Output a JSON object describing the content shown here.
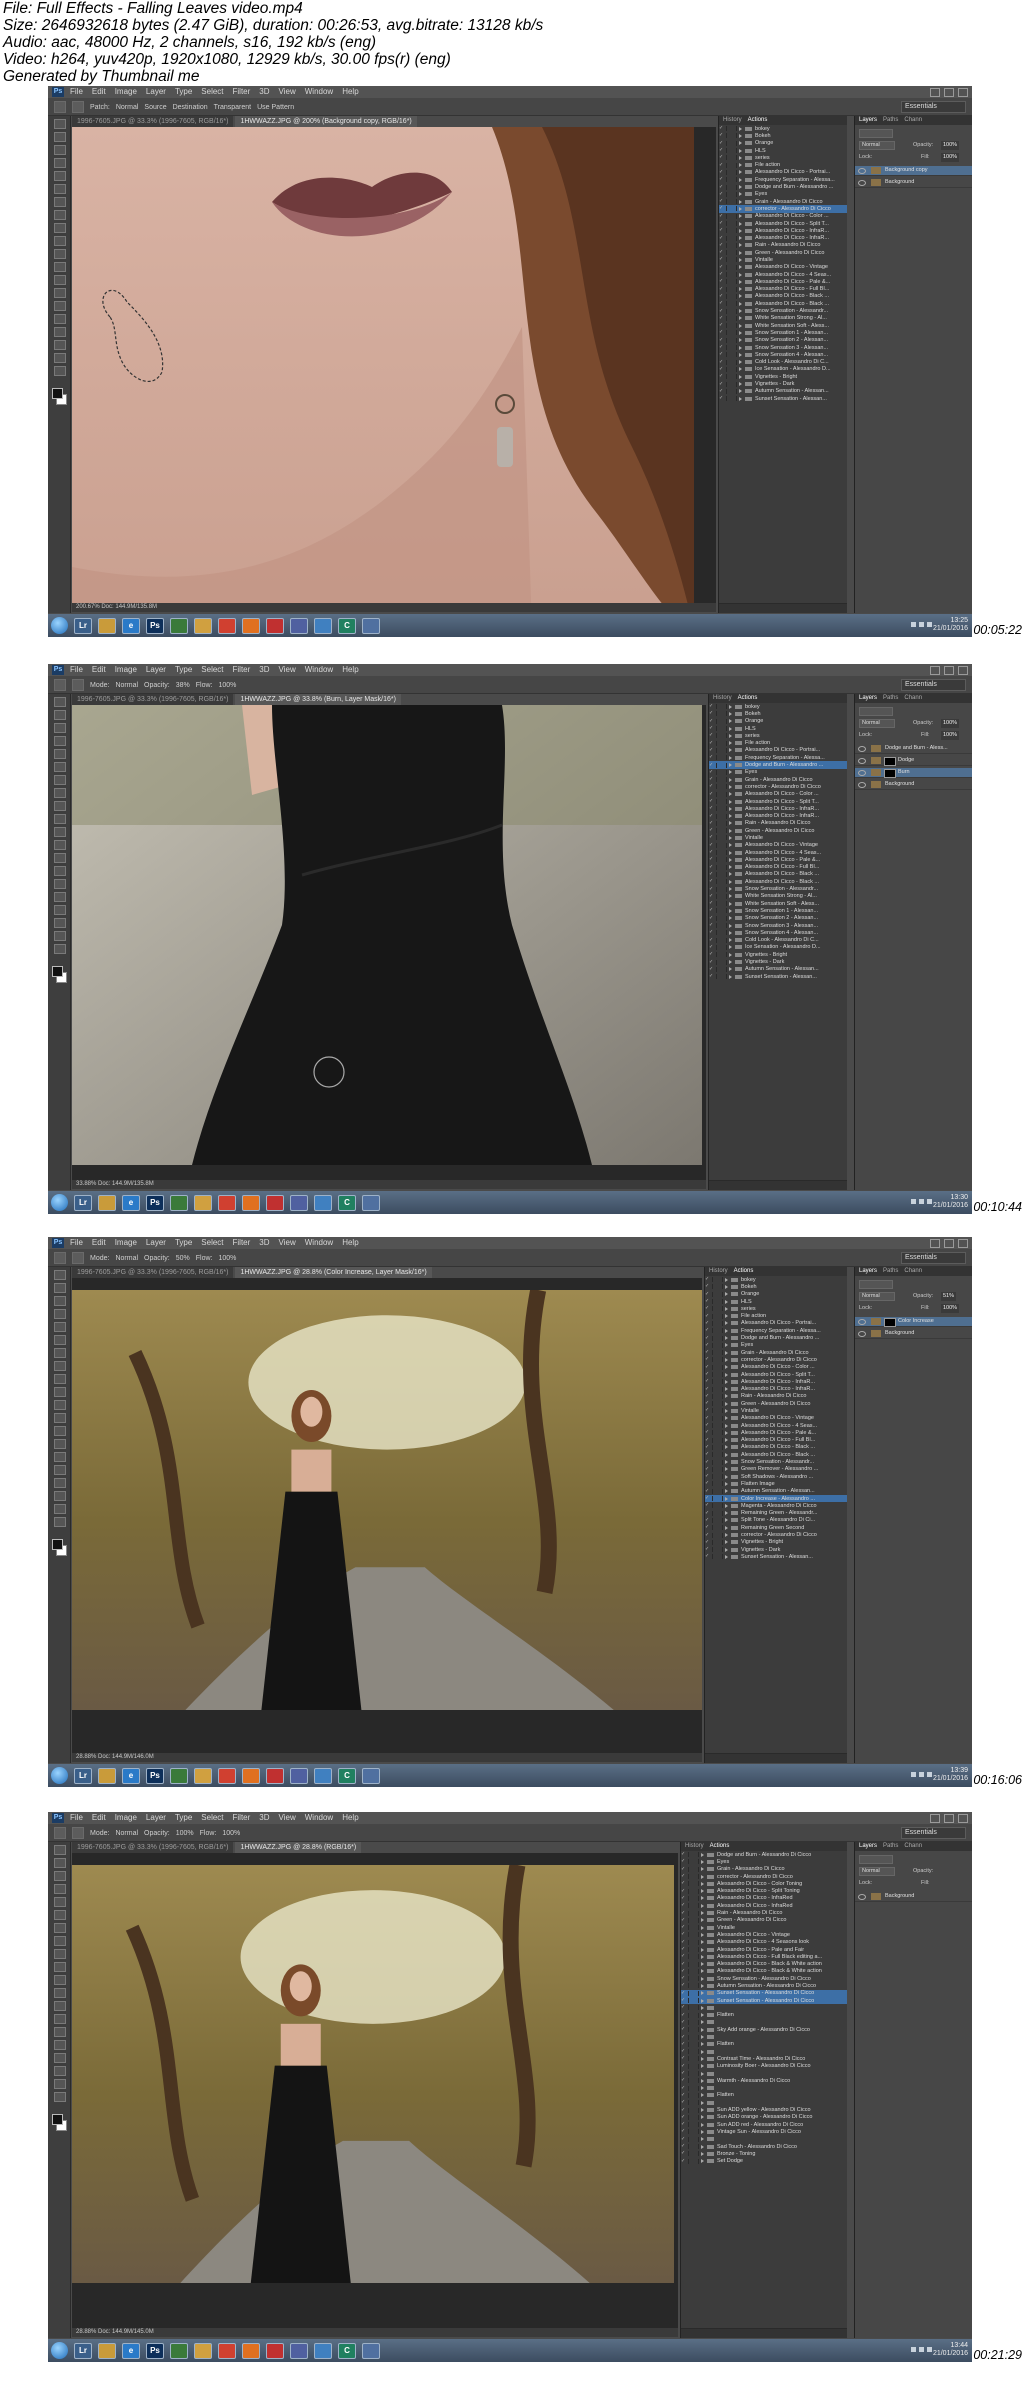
{
  "header": {
    "line1": "File: Full Effects - Falling Leaves video.mp4",
    "line2": "Size: 2646932618 bytes (2.47 GiB), duration: 00:26:53, avg.bitrate: 13128 kb/s",
    "line3": "Audio: aac, 48000 Hz, 2 channels, s16, 192 kb/s (eng)",
    "line4": "Video: h264, yuv420p, 1920x1080, 12929 kb/s, 30.00 fps(r) (eng)",
    "line5": "Generated by Thumbnail me"
  },
  "ps_menus": [
    "File",
    "Edit",
    "Image",
    "Layer",
    "Type",
    "Select",
    "Filter",
    "3D",
    "View",
    "Window",
    "Help"
  ],
  "workspace": "Essentials",
  "panel_tabs": {
    "history": "History",
    "actions": "Actions",
    "layers": "Layers",
    "paths": "Paths",
    "channels": "Chann"
  },
  "taskbar_icons": [
    "Lr",
    "e",
    "Ps",
    "C"
  ],
  "frames": [
    {
      "timestamp": "00:05:22",
      "options": [
        "Patch:",
        "Normal",
        "Source",
        "Destination",
        "Transparent",
        "Use Pattern"
      ],
      "tabs": [
        {
          "label": "1996-7605.JPG @ 33.3% (1996-7605, RGB/16*)",
          "active": false
        },
        {
          "label": "1HWWAZZ.JPG @ 200% (Background copy, RGB/16*)",
          "active": true
        }
      ],
      "status": "200.67%  Doc: 144.9M/135.8M",
      "clock": {
        "time": "13:25",
        "date": "21/01/2016"
      },
      "layers": {
        "blend": "Normal",
        "opacity_label": "Opacity:",
        "opacity": "100%",
        "fill_label": "Fill:",
        "fill": "100%",
        "lock": "Lock:",
        "items": [
          {
            "name": "Background copy",
            "selected": true,
            "mask": false
          },
          {
            "name": "Background",
            "selected": false,
            "mask": false
          }
        ]
      },
      "actions": [
        "bokey",
        "Bokeh",
        "Orange",
        "HLS",
        "series",
        "File action",
        "Alessandro Di Cicco - Portrai...",
        "Frequency Separation - Alessa...",
        "Dodge and Burn - Alessandro ...",
        "Eyes",
        "Grain - Alessandro Di Cicco",
        "corrector - Alessandro Di Cicco",
        "Alessandro Di Cicco - Color ...",
        "Alessandro Di Cicco - Split T...",
        "Alessandro Di Cicco - InfraR...",
        "Alessandro Di Cicco - InfraR...",
        "Rain - Alessandro Di Cicco",
        "Green - Alessandro Di Cicco",
        "Vintalle",
        "Alessandro Di Cicco - Vintage",
        "Alessandro Di Cicco - 4 Seas...",
        "Alessandro Di Cicco - Pale &...",
        "Alessandro Di Cicco - Full Bl...",
        "Alessandro Di Cicco - Black ...",
        "Alessandro Di Cicco - Black ...",
        "Snow Sensation - Alessandr...",
        "White Sensation Strong - Al...",
        "White Sensation Soft - Aless...",
        "Snow Sensation 1 - Alessan...",
        "Snow Sensation 2 - Alessan...",
        "Snow Sensation 3 - Alessan...",
        "Snow Sensation 4 - Alessan...",
        "Cold Look - Alessandro Di C...",
        "Ice Sensation - Alessandro D...",
        "Vignettes - Bright",
        "Vignettes - Dark",
        "Autumn Sensation - Alessan...",
        "Sunset Sensation - Alessan..."
      ],
      "selected_action": "corrector - Alessandro Di Cicco"
    },
    {
      "timestamp": "00:10:44",
      "options": [
        "Mode:",
        "Normal",
        "Opacity:",
        "38%",
        "Flow:",
        "100%"
      ],
      "tabs": [
        {
          "label": "1996-7605.JPG @ 33.3% (1996-7605, RGB/16*)",
          "active": false
        },
        {
          "label": "1HWWAZZ.JPG @ 33.8% (Burn, Layer Mask/16*)",
          "active": true
        }
      ],
      "status": "33.88%  Doc: 144.9M/135.8M",
      "clock": {
        "time": "13:30",
        "date": "21/01/2016"
      },
      "layers": {
        "blend": "Normal",
        "opacity_label": "Opacity:",
        "opacity": "100%",
        "fill_label": "Fill:",
        "fill": "100%",
        "lock": "Lock:",
        "items": [
          {
            "name": "Dodge and Burn - Aless...",
            "selected": false,
            "mask": false
          },
          {
            "name": "Dodge",
            "selected": false,
            "mask": true
          },
          {
            "name": "Burn",
            "selected": true,
            "mask": true
          },
          {
            "name": "Background",
            "selected": false,
            "mask": false
          }
        ]
      },
      "actions": [
        "bokey",
        "Bokeh",
        "Orange",
        "HLS",
        "series",
        "File action",
        "Alessandro Di Cicco - Portrai...",
        "Frequency Separation - Alessa...",
        "Dodge and Burn - Alessandro ...",
        "Eyes",
        "Grain - Alessandro Di Cicco",
        "corrector - Alessandro Di Cicco",
        "Alessandro Di Cicco - Color ...",
        "Alessandro Di Cicco - Split T...",
        "Alessandro Di Cicco - InfraR...",
        "Alessandro Di Cicco - InfraR...",
        "Rain - Alessandro Di Cicco",
        "Green - Alessandro Di Cicco",
        "Vintalle",
        "Alessandro Di Cicco - Vintage",
        "Alessandro Di Cicco - 4 Seas...",
        "Alessandro Di Cicco - Pale &...",
        "Alessandro Di Cicco - Full Bl...",
        "Alessandro Di Cicco - Black ...",
        "Alessandro Di Cicco - Black ...",
        "Snow Sensation - Alessandr...",
        "White Sensation Strong - Al...",
        "White Sensation Soft - Aless...",
        "Snow Sensation 1 - Alessan...",
        "Snow Sensation 2 - Alessan...",
        "Snow Sensation 3 - Alessan...",
        "Snow Sensation 4 - Alessan...",
        "Cold Look - Alessandro Di C...",
        "Ice Sensation - Alessandro D...",
        "Vignettes - Bright",
        "Vignettes - Dark",
        "Autumn Sensation - Alessan...",
        "Sunset Sensation - Alessan..."
      ],
      "selected_action": "Dodge and Burn - Alessandro ..."
    },
    {
      "timestamp": "00:16:06",
      "options": [
        "Mode:",
        "Normal",
        "Opacity:",
        "50%",
        "Flow:",
        "100%"
      ],
      "tabs": [
        {
          "label": "1996-7605.JPG @ 33.3% (1996-7605, RGB/16*)",
          "active": false
        },
        {
          "label": "1HWWAZZ.JPG @ 28.8% (Color Increase, Layer Mask/16*)",
          "active": true
        }
      ],
      "status": "28.88%  Doc: 144.9M/146.0M",
      "clock": {
        "time": "13:39",
        "date": "21/01/2016"
      },
      "layers": {
        "blend": "Normal",
        "opacity_label": "Opacity:",
        "opacity": "51%",
        "fill_label": "Fill:",
        "fill": "100%",
        "lock": "Lock:",
        "items": [
          {
            "name": "Color Increase",
            "selected": true,
            "mask": true
          },
          {
            "name": "Background",
            "selected": false,
            "mask": false
          }
        ]
      },
      "actions": [
        "bokey",
        "Bokeh",
        "Orange",
        "HLS",
        "series",
        "File action",
        "Alessandro Di Cicco - Portrai...",
        "Frequency Separation - Alessa...",
        "Dodge and Burn - Alessandro ...",
        "Eyes",
        "Grain - Alessandro Di Cicco",
        "corrector - Alessandro Di Cicco",
        "Alessandro Di Cicco - Color ...",
        "Alessandro Di Cicco - Split T...",
        "Alessandro Di Cicco - InfraR...",
        "Alessandro Di Cicco - InfraR...",
        "Rain - Alessandro Di Cicco",
        "Green - Alessandro Di Cicco",
        "Vintalle",
        "Alessandro Di Cicco - Vintage",
        "Alessandro Di Cicco - 4 Seas...",
        "Alessandro Di Cicco - Pale &...",
        "Alessandro Di Cicco - Full Bl...",
        "Alessandro Di Cicco - Black ...",
        "Alessandro Di Cicco - Black ...",
        "Snow Sensation - Alessandr...",
        "Green Remover - Alessandro ...",
        "Soft Shadows - Alessandro ...",
        "Flatten Image",
        "Autumn Sensation - Alessan...",
        "Color Increase - Alessandro ...",
        "Magenta - Alessandro Di Cicco",
        "Remaining Green - Alessandr...",
        "Split Tone - Alessandro Di Ci...",
        "Remaining Green Second",
        "corrector - Alessandro Di Cicco",
        "Vignettes - Bright",
        "Vignettes - Dark",
        "Sunset Sensation - Alessan..."
      ],
      "selected_action": "Color Increase - Alessandro ..."
    },
    {
      "timestamp": "00:21:29",
      "options": [
        "Mode:",
        "Normal",
        "Opacity:",
        "100%",
        "Flow:",
        "100%"
      ],
      "tabs": [
        {
          "label": "1996-7605.JPG @ 33.3% (1996-7605, RGB/16*)",
          "active": false
        },
        {
          "label": "1HWWAZZ.JPG @ 28.8% (RGB/16*)",
          "active": true
        }
      ],
      "status": "28.88%  Doc: 144.9M/145.0M",
      "clock": {
        "time": "13:44",
        "date": "21/01/2016"
      },
      "layers": {
        "blend": "Normal",
        "opacity_label": "Opacity:",
        "opacity": "",
        "fill_label": "Fill:",
        "fill": "",
        "lock": "Lock:",
        "items": [
          {
            "name": "Background",
            "selected": false,
            "mask": false
          }
        ]
      },
      "actions": [
        "Dodge and Burn - Alessandro Di Cicco",
        "Eyes",
        "Grain - Alessandro Di Cicco",
        "corrector - Alessandro Di Cicco",
        "Alessandro Di Cicco - Color Toning",
        "Alessandro Di Cicco - Split Toning",
        "Alessandro Di Cicco - InfraRed",
        "Alessandro Di Cicco - InfraRed",
        "Rain - Alessandro Di Cicco",
        "Green - Alessandro Di Cicco",
        "Vintalle",
        "Alessandro Di Cicco - Vintage",
        "Alessandro Di Cicco - 4 Seasons look",
        "Alessandro Di Cicco - Pale and Fair",
        "Alessandro Di Cicco - Full Black editing a...",
        "Alessandro Di Cicco - Black & White action",
        "Alessandro Di Cicco - Black & White action",
        "Snow Sensation - Alessandro Di Cicco",
        "Autumn Sensation - Alessandro Di Cicco",
        "Sunset Sensation - Alessandro Di Cicco",
        "Sunset Sensation - Alessandro Di Cicco",
        "",
        "Flatten",
        "",
        "Sky Add orange - Alessandro Di Cicco",
        "",
        "Flatten",
        "",
        "Contrast Time - Alessandro Di Cicco",
        "Luminosity Boer - Alessandro Di Cicco",
        "",
        "Warmth - Alessandro Di Cicco",
        "",
        "Flatten",
        "",
        "Sun ADD yellow - Alessandro Di Cicco",
        "Sun ADD orange - Alessandro Di Cicco",
        "Sun ADD red - Alessandro Di Cicco",
        "Vintage Sun - Alessandro Di Cicco",
        "",
        "Sad Touch - Alessandro Di Cicco",
        "Bronze - Toning",
        "Set Dodge"
      ],
      "selected_action": "Sunset Sensation - Alessandro Di Cicco"
    }
  ]
}
